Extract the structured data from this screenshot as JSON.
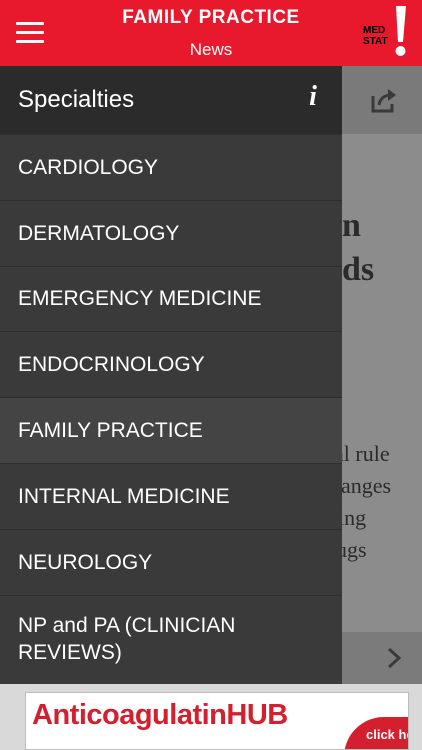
{
  "header": {
    "title": "FAMILY PRACTICE",
    "subtitle": "News",
    "logo_top": "MED",
    "logo_bottom": "STAT"
  },
  "drawer": {
    "title": "Specialties",
    "info_glyph": "i",
    "items": [
      {
        "label": "CARDIOLOGY"
      },
      {
        "label": "DERMATOLOGY"
      },
      {
        "label": "EMERGENCY MEDICINE"
      },
      {
        "label": "ENDOCRINOLOGY"
      },
      {
        "label": "FAMILY PRACTICE"
      },
      {
        "label": "INTERNAL MEDICINE"
      },
      {
        "label": "NEUROLOGY"
      },
      {
        "label": "NP and PA (CLINICIAN REVIEWS)"
      }
    ],
    "selected": "FAMILY PRACTICE"
  },
  "behind": {
    "line1": "n",
    "line2": "ds",
    "line3": "al rule",
    "line4": "nanges",
    "line5": "ing",
    "line6": "ugs"
  },
  "ad": {
    "title_a": "Anticoagulati",
    "title_b": "n",
    "title_c": "HUB",
    "cta": "click here"
  },
  "colors": {
    "brand_red": "#e8192c",
    "drawer_bg": "#3a3a3a",
    "drawer_head_bg": "#2b2b2b"
  }
}
